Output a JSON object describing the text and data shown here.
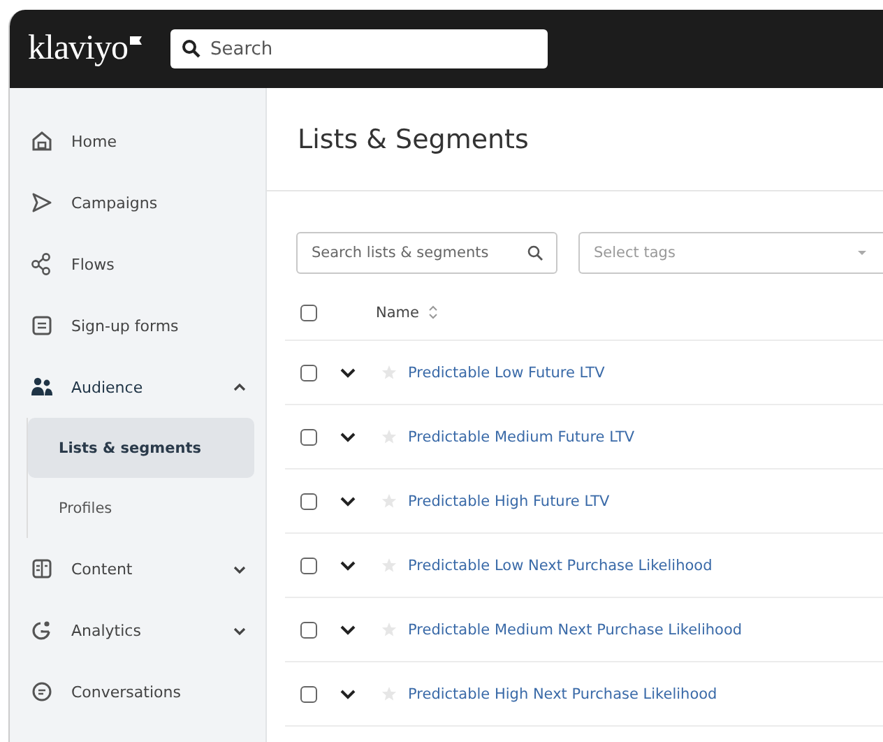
{
  "topbar": {
    "logo": "klaviyo",
    "search": {
      "placeholder": "Search"
    }
  },
  "sidebar": {
    "items": [
      {
        "label": "Home",
        "selected": false
      },
      {
        "label": "Campaigns",
        "selected": false
      },
      {
        "label": "Flows",
        "selected": false
      },
      {
        "label": "Sign-up forms",
        "selected": false
      },
      {
        "label": "Audience",
        "selected": false,
        "expanded": true,
        "children": [
          {
            "label": "Lists & segments",
            "selected": true
          },
          {
            "label": "Profiles",
            "selected": false
          }
        ]
      },
      {
        "label": "Content",
        "selected": false,
        "expanded": false
      },
      {
        "label": "Analytics",
        "selected": false,
        "expanded": false
      },
      {
        "label": "Conversations",
        "selected": false
      }
    ]
  },
  "main": {
    "title": "Lists & Segments",
    "search": {
      "placeholder": "Search lists & segments"
    },
    "tags": {
      "placeholder": "Select tags"
    },
    "table": {
      "header": {
        "checked": false,
        "label": "Name"
      },
      "rows": [
        {
          "name": "Predictable Low Future LTV",
          "checked": false,
          "starred": false
        },
        {
          "name": "Predictable Medium Future LTV",
          "checked": false,
          "starred": false
        },
        {
          "name": "Predictable High Future LTV",
          "checked": false,
          "starred": false
        },
        {
          "name": "Predictable Low Next Purchase Likelihood",
          "checked": false,
          "starred": false
        },
        {
          "name": "Predictable Medium Next Purchase Likelihood",
          "checked": false,
          "starred": false
        },
        {
          "name": "Predictable High Next Purchase Likelihood",
          "checked": false,
          "starred": false
        }
      ]
    }
  }
}
